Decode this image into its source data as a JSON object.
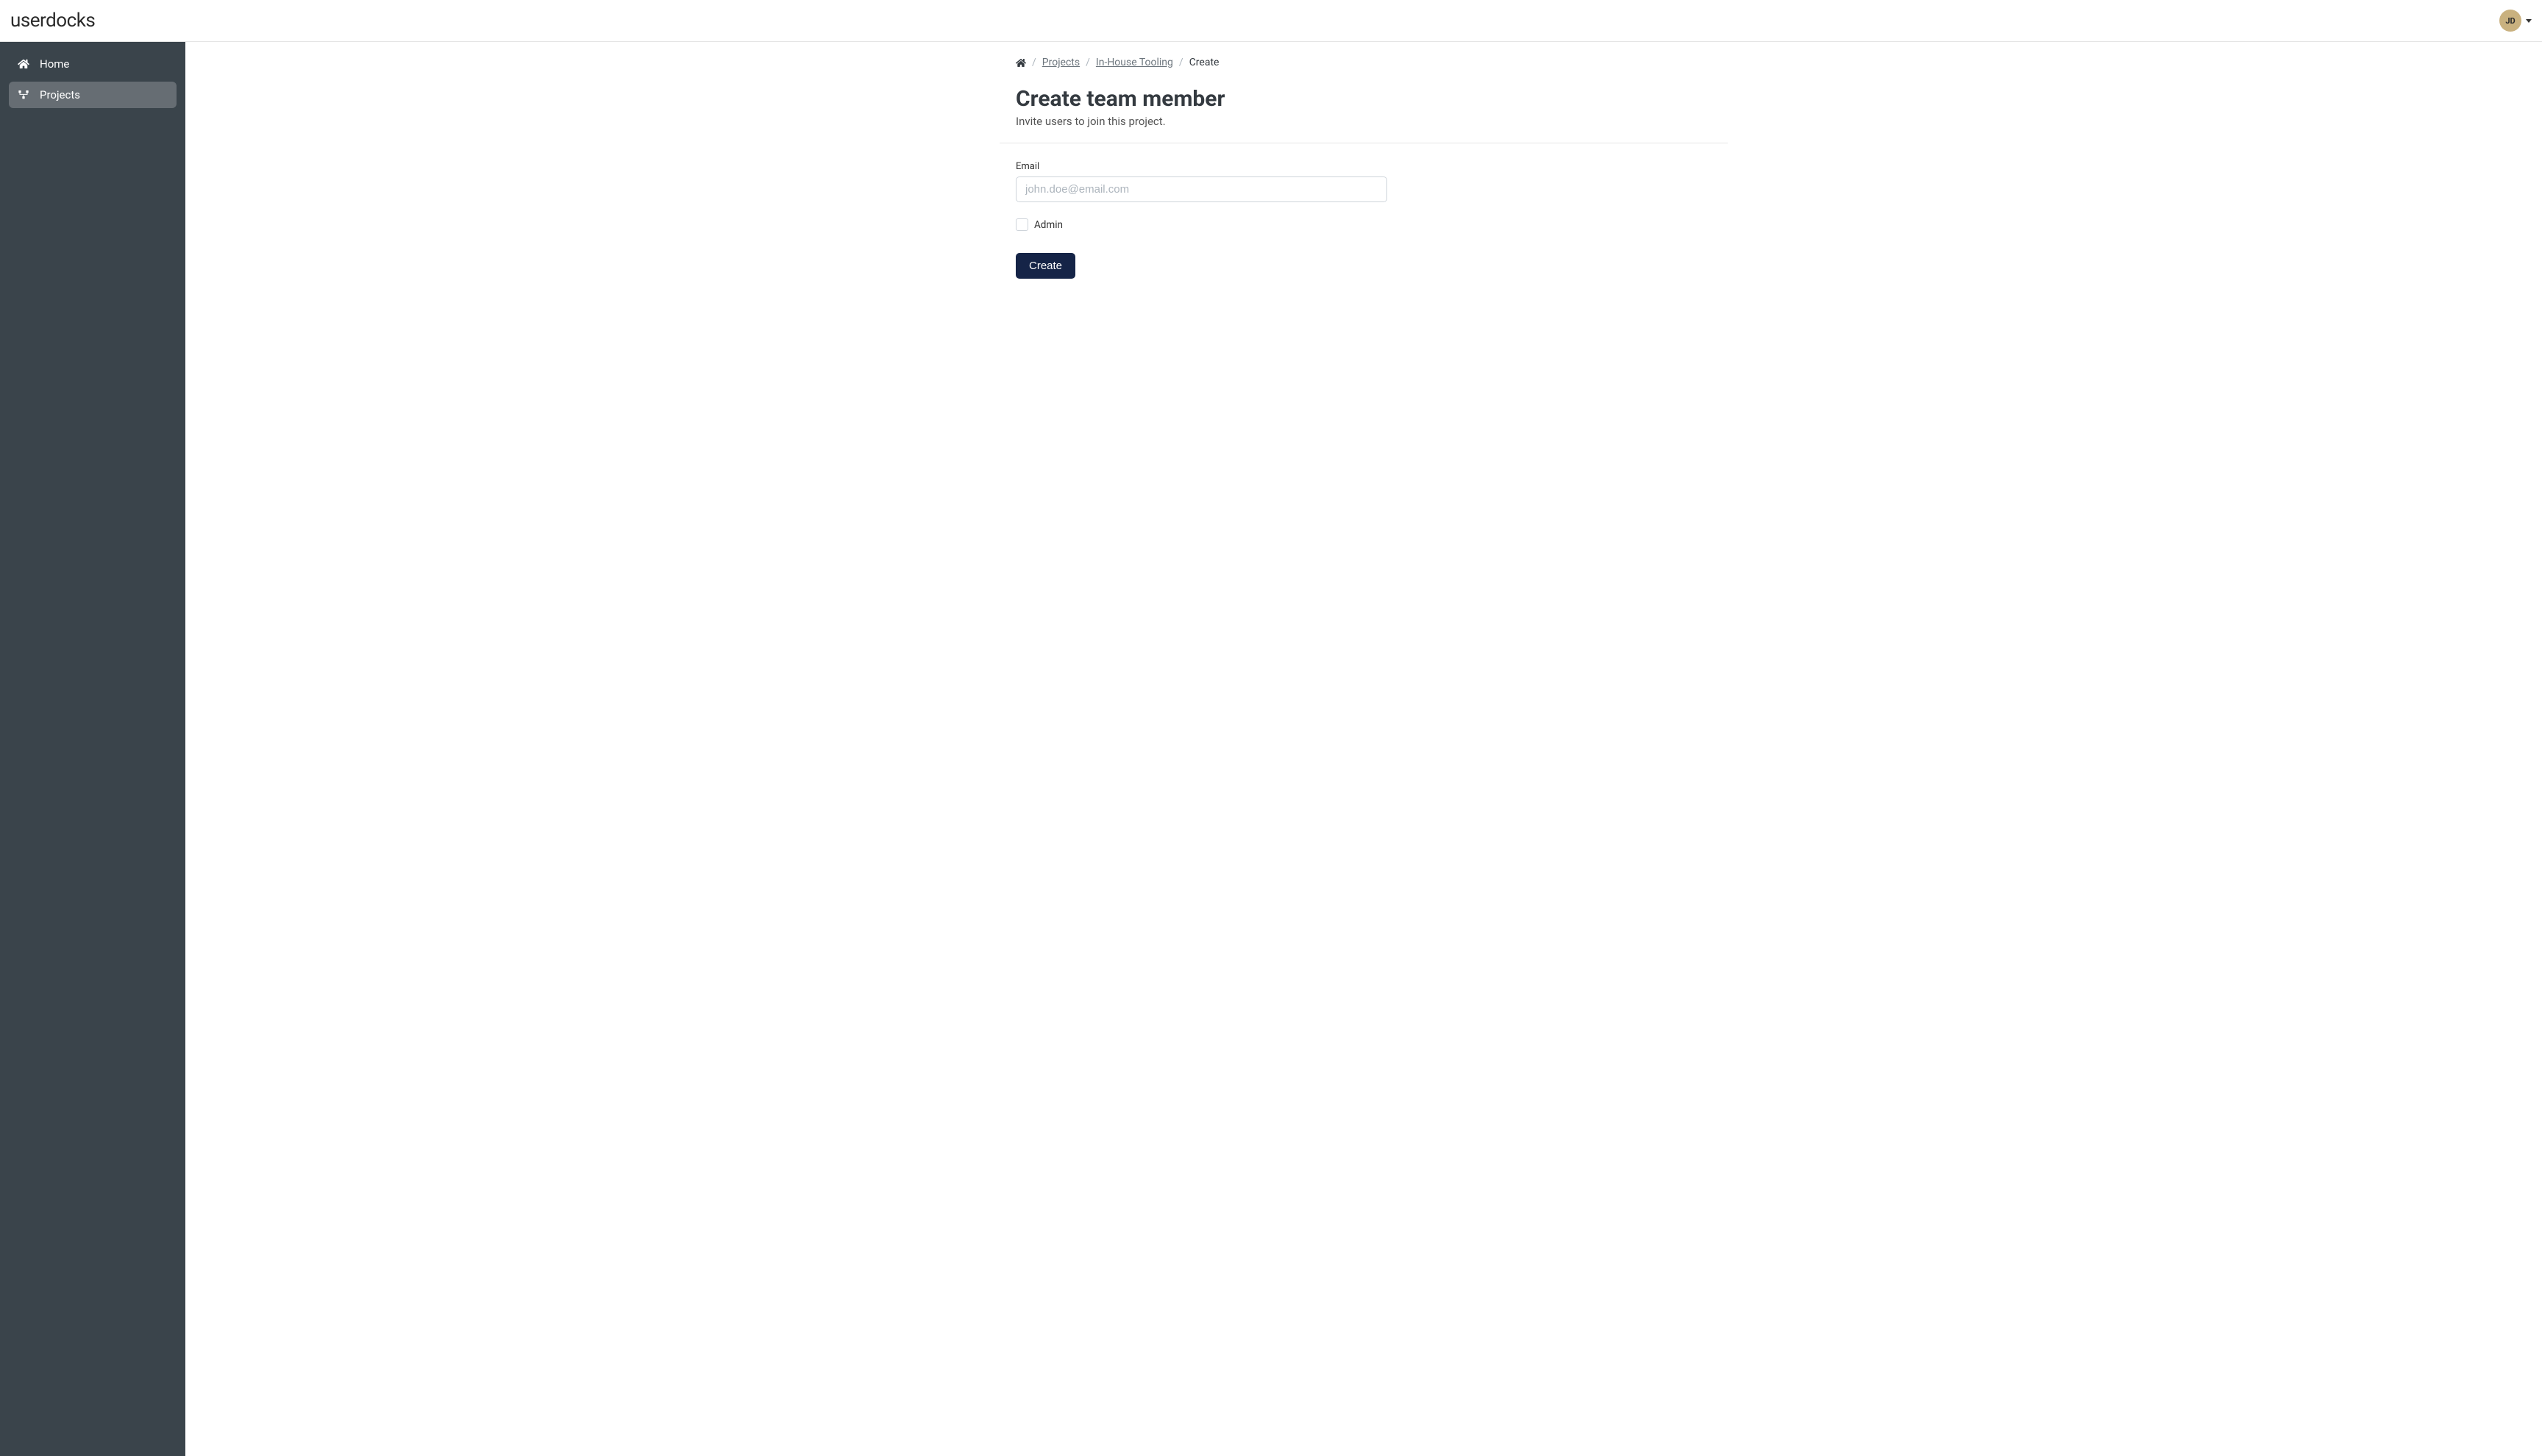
{
  "header": {
    "brand": "userdocks",
    "user_initials": "JD"
  },
  "sidebar": {
    "items": [
      {
        "label": "Home",
        "icon": "home-icon",
        "active": false
      },
      {
        "label": "Projects",
        "icon": "projects-icon",
        "active": true
      }
    ]
  },
  "breadcrumb": {
    "items": [
      {
        "label": "Projects",
        "link": true
      },
      {
        "label": "In-House Tooling",
        "link": true
      },
      {
        "label": "Create",
        "link": false
      }
    ]
  },
  "page": {
    "title": "Create team member",
    "subtitle": "Invite users to join this project."
  },
  "form": {
    "email_label": "Email",
    "email_placeholder": "john.doe@email.com",
    "email_value": "",
    "admin_label": "Admin",
    "admin_checked": false,
    "submit_label": "Create"
  }
}
